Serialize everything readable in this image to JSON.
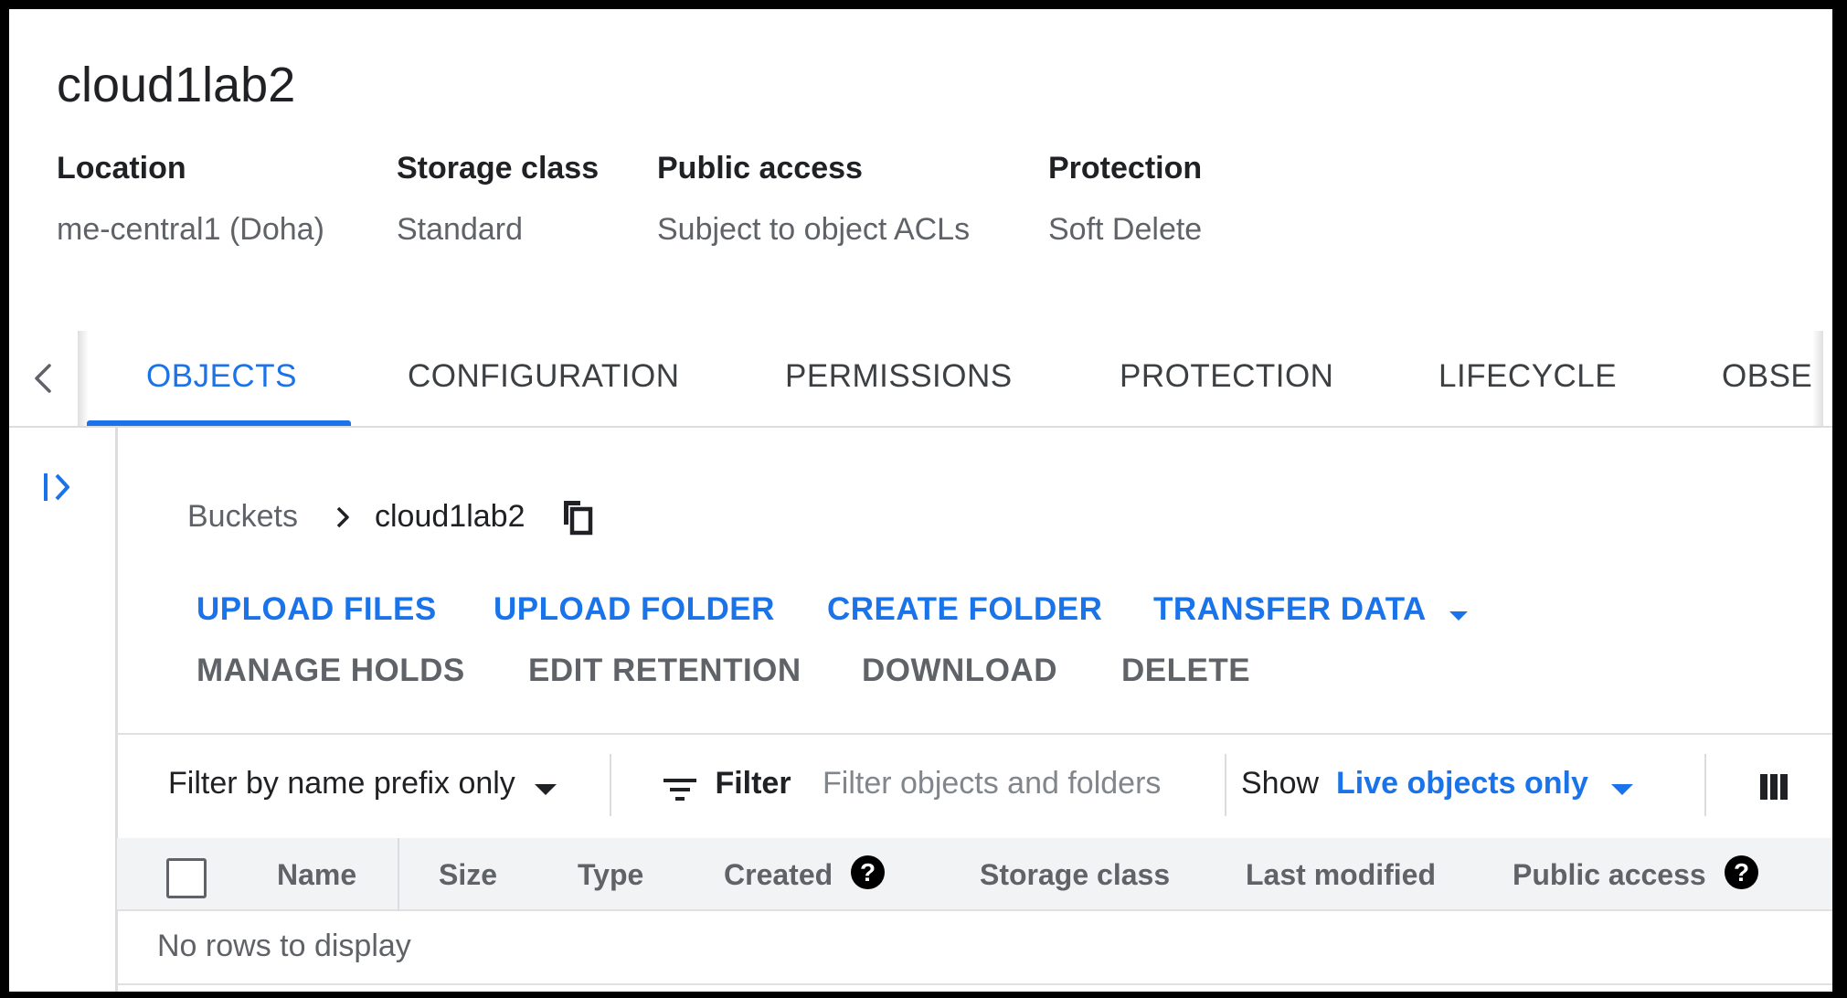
{
  "bucket": {
    "name": "cloud1lab2",
    "meta": [
      {
        "label": "Location",
        "value": "me-central1 (Doha)"
      },
      {
        "label": "Storage class",
        "value": "Standard"
      },
      {
        "label": "Public access",
        "value": "Subject to object ACLs"
      },
      {
        "label": "Protection",
        "value": "Soft Delete"
      }
    ]
  },
  "tabs": [
    {
      "label": "OBJECTS",
      "active": true
    },
    {
      "label": "CONFIGURATION"
    },
    {
      "label": "PERMISSIONS"
    },
    {
      "label": "PROTECTION"
    },
    {
      "label": "LIFECYCLE"
    },
    {
      "label": "OBSE"
    }
  ],
  "breadcrumb": {
    "root": "Buckets",
    "current": "cloud1lab2"
  },
  "actions": {
    "primary": [
      "UPLOAD FILES",
      "UPLOAD FOLDER",
      "CREATE FOLDER",
      "TRANSFER DATA"
    ],
    "secondary": [
      "MANAGE HOLDS",
      "EDIT RETENTION",
      "DOWNLOAD",
      "DELETE"
    ]
  },
  "filter": {
    "mode_label": "Filter by name prefix only",
    "filter_label": "Filter",
    "placeholder": "Filter objects and folders",
    "show_label": "Show",
    "show_value": "Live objects only"
  },
  "table": {
    "columns": [
      "Name",
      "Size",
      "Type",
      "Created",
      "Storage class",
      "Last modified",
      "Public access"
    ],
    "empty_message": "No rows to display"
  },
  "colors": {
    "accent": "#1a73e8",
    "muted": "#5f6368"
  }
}
